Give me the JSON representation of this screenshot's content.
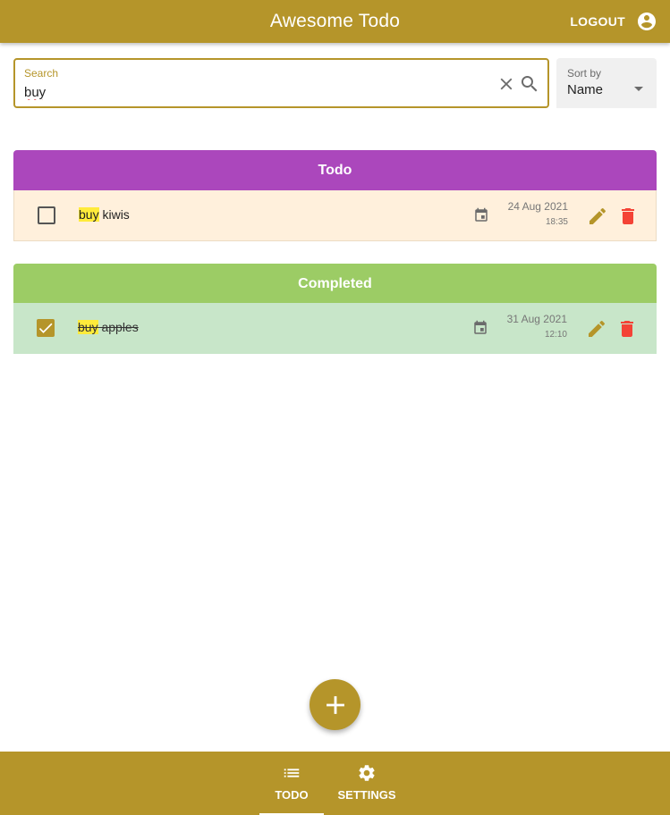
{
  "app": {
    "title": "Awesome Todo",
    "logout_label": "LOGOUT",
    "account_icon": "account-circle-icon"
  },
  "search": {
    "label": "Search",
    "value": "buy",
    "clear_icon": "close-icon",
    "search_icon": "search-icon"
  },
  "sort": {
    "label": "Sort by",
    "value": "Name",
    "caret_icon": "arrow-drop-down-icon"
  },
  "sections": {
    "todo": {
      "title": "Todo",
      "items": [
        {
          "highlight": "buy",
          "rest": " kiwis",
          "date": "24 Aug 2021",
          "time": "18:35",
          "completed": false
        }
      ]
    },
    "completed": {
      "title": "Completed",
      "items": [
        {
          "highlight": "buy",
          "rest": " apples",
          "date": "31 Aug 2021",
          "time": "12:10",
          "completed": true
        }
      ]
    }
  },
  "fab": {
    "icon": "add-icon"
  },
  "bottom_nav": {
    "items": [
      {
        "label": "TODO",
        "icon": "list-icon",
        "active": true
      },
      {
        "label": "SETTINGS",
        "icon": "settings-icon",
        "active": false
      }
    ]
  },
  "colors": {
    "primary": "#b5952a",
    "todo_header": "#ab47bc",
    "completed_header": "#9ccc65",
    "todo_row": "#fff0dc",
    "completed_row": "#c8e6c9",
    "highlight": "#ffeb3b",
    "delete": "#f44336"
  }
}
